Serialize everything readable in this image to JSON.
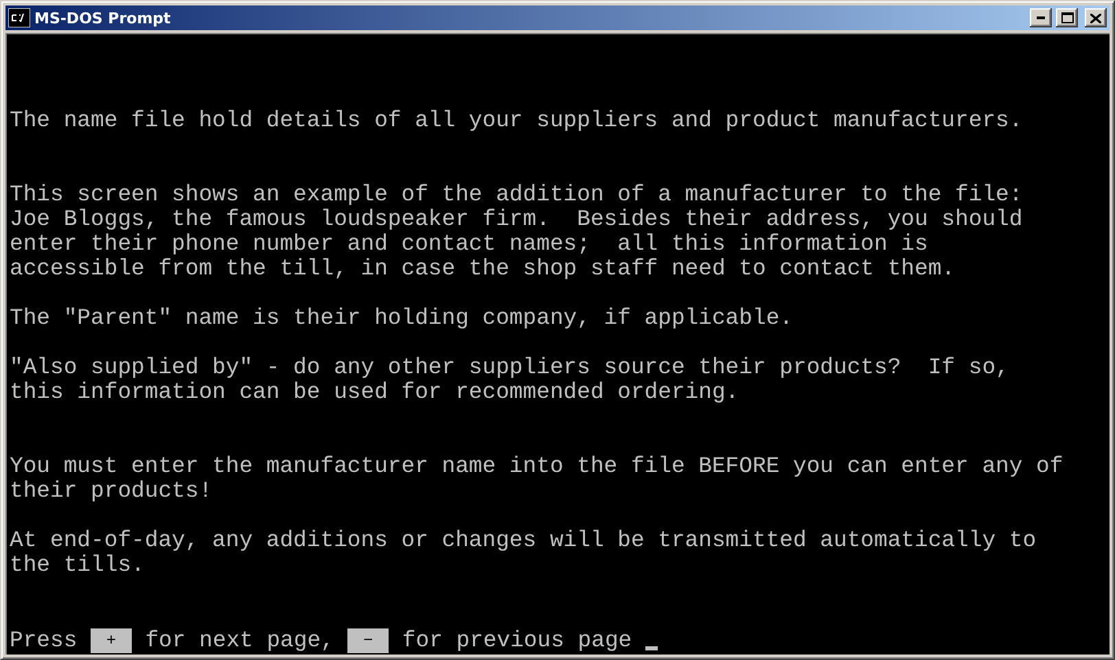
{
  "window": {
    "title": "MS-DOS Prompt"
  },
  "paragraphs": [
    {
      "kind": "lead",
      "lines": [
        "The name file hold details of all your suppliers and product manufacturers."
      ]
    },
    {
      "kind": "wide",
      "lines": [
        "This screen shows an example of the addition of a manufacturer to the file:",
        "Joe Bloggs, the famous loudspeaker firm.  Besides their address, you should",
        "enter their phone number and contact names;  all this information is",
        "accessible from the till, in case the shop staff need to contact them."
      ]
    },
    {
      "kind": "narrow",
      "lines": [
        "The \"Parent\" name is their holding company, if applicable."
      ]
    },
    {
      "kind": "narrow",
      "lines": [
        "\"Also supplied by\" - do any other suppliers source their products?  If so,",
        "this information can be used for recommended ordering."
      ]
    },
    {
      "kind": "wide",
      "lines": [
        "You must enter the manufacturer name into the file BEFORE you can enter any of",
        "their products!"
      ]
    },
    {
      "kind": "narrow",
      "lines": [
        "At end-of-day, any additions or changes will be transmitted automatically to",
        "the tills."
      ]
    }
  ],
  "prompt": {
    "cursor": true,
    "segments": [
      {
        "kind": "text",
        "text": "Press"
      },
      {
        "kind": "key",
        "text": "+"
      },
      {
        "kind": "text",
        "text": "for next page,"
      },
      {
        "kind": "key",
        "text": "−"
      },
      {
        "kind": "text",
        "text": "for previous page"
      }
    ]
  }
}
